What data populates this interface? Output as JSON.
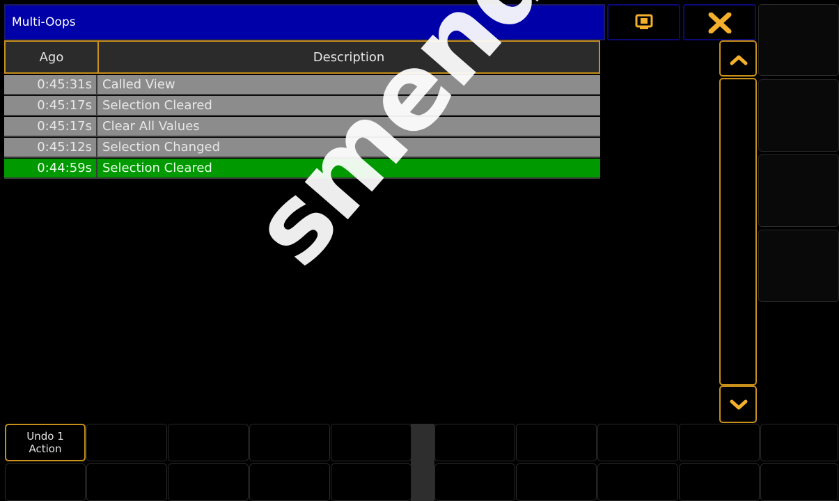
{
  "window": {
    "title": "Multi-Oops"
  },
  "table": {
    "columns": [
      "Ago",
      "Description"
    ],
    "rows": [
      {
        "ago": "0:45:31s",
        "description": "Called View",
        "active": false
      },
      {
        "ago": "0:45:17s",
        "description": "Selection Cleared",
        "active": false
      },
      {
        "ago": "0:45:17s",
        "description": "Clear All Values",
        "active": false
      },
      {
        "ago": "0:45:12s",
        "description": "Selection Changed",
        "active": false
      },
      {
        "ago": "0:44:59s",
        "description": "Selection Cleared",
        "active": true
      }
    ]
  },
  "icons": {
    "view": "screen-view-icon",
    "close": "close-x-icon",
    "scroll_up": "chevron-up-icon",
    "scroll_down": "chevron-down-icon"
  },
  "buttons": {
    "undo_line1": "Undo 1",
    "undo_line2": "Action"
  },
  "watermark": "smendoza.com",
  "colors": {
    "title_bar": "#0000a8",
    "accent": "#c8901a",
    "row_grey": "#8c8c8c",
    "row_active": "#009900"
  }
}
